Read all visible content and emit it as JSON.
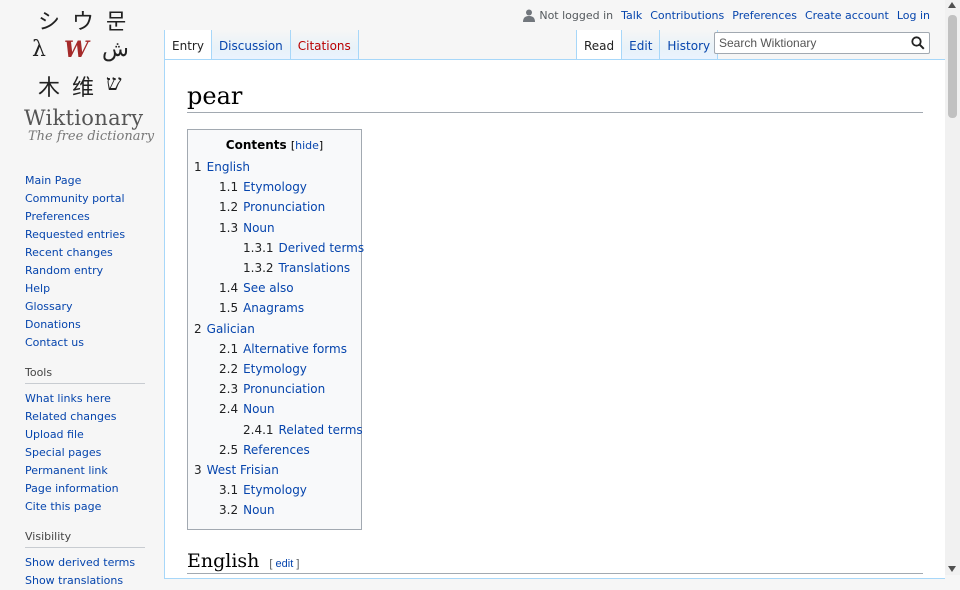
{
  "logo": {
    "glyphs": [
      "シ",
      "ウ",
      "문",
      "λ",
      "W",
      "ش",
      "木",
      "维",
      "ש"
    ],
    "title": "Wiktionary",
    "tagline": "The free dictionary"
  },
  "personal": {
    "not_logged_in": "Not logged in",
    "talk": "Talk",
    "contributions": "Contributions",
    "preferences": "Preferences",
    "create_account": "Create account",
    "log_in": "Log in"
  },
  "tabs": {
    "entry": "Entry",
    "discussion": "Discussion",
    "citations": "Citations",
    "read": "Read",
    "edit": "Edit",
    "history": "History"
  },
  "search": {
    "placeholder": "Search Wiktionary"
  },
  "sidebar": {
    "navigation": [
      "Main Page",
      "Community portal",
      "Preferences",
      "Requested entries",
      "Recent changes",
      "Random entry",
      "Help",
      "Glossary",
      "Donations",
      "Contact us"
    ],
    "tools_heading": "Tools",
    "tools": [
      "What links here",
      "Related changes",
      "Upload file",
      "Special pages",
      "Permanent link",
      "Page information",
      "Cite this page"
    ],
    "visibility_heading": "Visibility",
    "visibility": [
      "Show derived terms",
      "Show translations"
    ]
  },
  "page": {
    "title": "pear",
    "toc_title": "Contents",
    "toc_hide": "hide",
    "toc": [
      {
        "num": "1",
        "label": "English",
        "level": 1
      },
      {
        "num": "1.1",
        "label": "Etymology",
        "level": 2
      },
      {
        "num": "1.2",
        "label": "Pronunciation",
        "level": 2
      },
      {
        "num": "1.3",
        "label": "Noun",
        "level": 2
      },
      {
        "num": "1.3.1",
        "label": "Derived terms",
        "level": 3
      },
      {
        "num": "1.3.2",
        "label": "Translations",
        "level": 3
      },
      {
        "num": "1.4",
        "label": "See also",
        "level": 2
      },
      {
        "num": "1.5",
        "label": "Anagrams",
        "level": 2
      },
      {
        "num": "2",
        "label": "Galician",
        "level": 1
      },
      {
        "num": "2.1",
        "label": "Alternative forms",
        "level": 2
      },
      {
        "num": "2.2",
        "label": "Etymology",
        "level": 2
      },
      {
        "num": "2.3",
        "label": "Pronunciation",
        "level": 2
      },
      {
        "num": "2.4",
        "label": "Noun",
        "level": 2
      },
      {
        "num": "2.4.1",
        "label": "Related terms",
        "level": 3
      },
      {
        "num": "2.5",
        "label": "References",
        "level": 2
      },
      {
        "num": "3",
        "label": "West Frisian",
        "level": 1
      },
      {
        "num": "3.1",
        "label": "Etymology",
        "level": 2
      },
      {
        "num": "3.2",
        "label": "Noun",
        "level": 2
      }
    ],
    "section_english": "English",
    "edit_label": "edit"
  }
}
